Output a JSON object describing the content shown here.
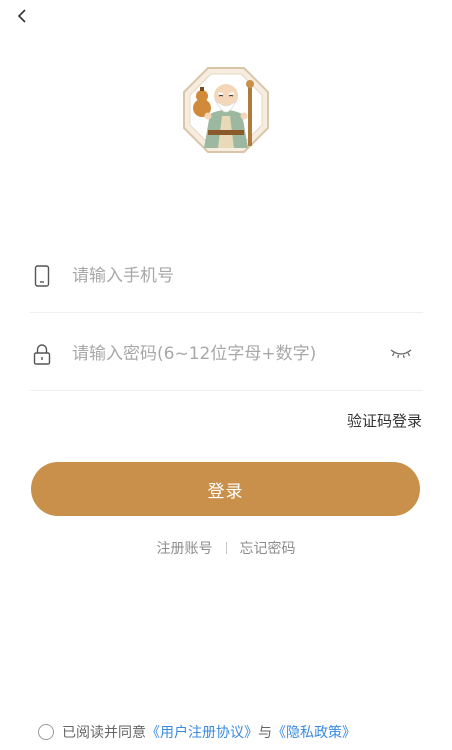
{
  "header": {
    "back_icon": "chevron-left-icon"
  },
  "logo": {
    "description_icon": "sage-mascot-logo"
  },
  "form": {
    "phone": {
      "icon": "mobile-phone-icon",
      "placeholder": "请输入手机号",
      "value": ""
    },
    "password": {
      "icon": "lock-icon",
      "placeholder": "请输入密码(6~12位字母+数字)",
      "value": "",
      "toggle_icon": "eye-closed-icon"
    },
    "sms_login_label": "验证码登录",
    "login_button_label": "登录"
  },
  "links": {
    "register": "注册账号",
    "forgot_password": "忘记密码"
  },
  "agreement": {
    "checked": false,
    "prefix": "已阅读并同意",
    "user_agreement": "《用户注册协议》",
    "connector": "与",
    "privacy_policy": "《隐私政策》"
  },
  "colors": {
    "accent": "#c8904a",
    "link": "#3a8be0",
    "placeholder": "#a8a8a8"
  }
}
